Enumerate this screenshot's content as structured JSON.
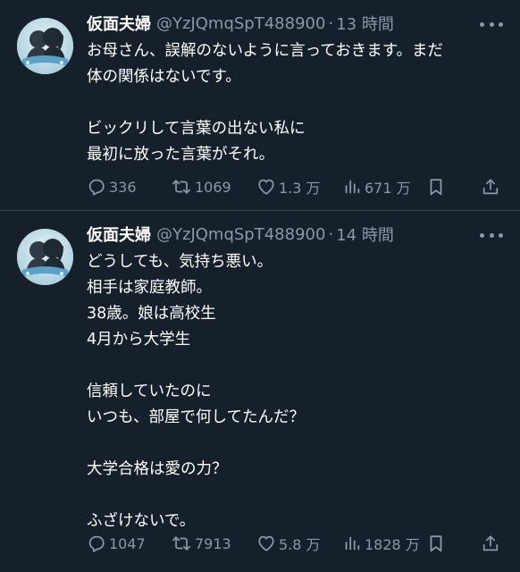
{
  "tweets": [
    {
      "name": "仮面夫婦",
      "handle": "@YzJQmqSpT488900",
      "separator": "·",
      "time": "13 時間",
      "lines": [
        "お母さん、誤解のないように言っておきます。まだ",
        "体の関係はないです。",
        "",
        "ビックリして言葉の出ない私に",
        "最初に放った言葉がそれ。"
      ],
      "replies": "336",
      "retweets": "1069",
      "likes": "1.3 万",
      "views": "671 万"
    },
    {
      "name": "仮面夫婦",
      "handle": "@YzJQmqSpT488900",
      "separator": "·",
      "time": "14 時間",
      "lines": [
        "どうしても、気持ち悪い。",
        "相手は家庭教師。",
        "38歳。娘は高校生",
        "4月から大学生",
        "",
        "信頼していたのに",
        "いつも、部屋で何してたんだ？",
        "",
        "大学合格は愛の力？",
        "",
        "ふざけないで。"
      ],
      "replies": "1047",
      "retweets": "7913",
      "likes": "5.8 万",
      "views": "1828 万"
    }
  ],
  "icons": {
    "reply": "speech-bubble-icon",
    "retweet": "retweet-arrows-icon",
    "like": "heart-icon",
    "views": "bar-chart-icon",
    "bookmark": "bookmark-icon",
    "share": "share-upload-icon",
    "more": "more-dots-icon"
  },
  "colors": {
    "background": "#15202b",
    "text": "#ffffff",
    "secondary": "#8b98a5",
    "divider": "#38444d"
  }
}
